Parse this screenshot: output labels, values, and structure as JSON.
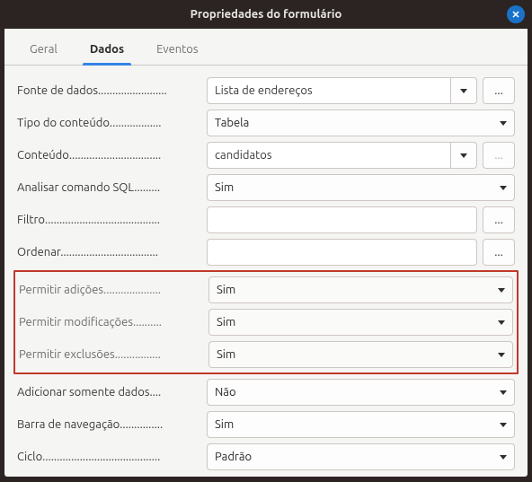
{
  "window": {
    "title": "Propriedades do formulário"
  },
  "tabs": {
    "general": "Geral",
    "data": "Dados",
    "events": "Eventos"
  },
  "labels": {
    "datasource": "Fonte de dados........................",
    "content_type": "Tipo do conteúdo..................",
    "content": "Conteúdo................................",
    "analyze_sql": "Analisar comando SQL.........",
    "filter": "Filtro........................................",
    "sort": "Ordenar..................................",
    "allow_add": "Permitir adições....................",
    "allow_mod": "Permitir modificações..........",
    "allow_del": "Permitir exclusões................",
    "data_only": "Adicionar somente dados....",
    "navbar": "Barra de navegação...............",
    "cycle": "Ciclo........................................."
  },
  "values": {
    "datasource": "Lista de endereços",
    "content_type": "Tabela",
    "content": "candidatos",
    "analyze_sql": "Sim",
    "filter": "",
    "sort": "",
    "allow_add": "Sim",
    "allow_mod": "Sim",
    "allow_del": "Sim",
    "data_only": "Não",
    "navbar": "Sim",
    "cycle": "Padrão"
  },
  "glyphs": {
    "dots": "..."
  }
}
